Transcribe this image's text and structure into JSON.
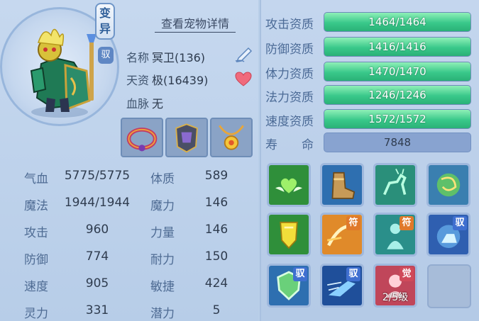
{
  "pet": {
    "mutant_label_1": "变",
    "mutant_label_2": "异",
    "skill_badge": "驭",
    "detail_link": "查看宠物详情",
    "name_label": "名称",
    "name_value": "冥卫(136)",
    "talent_label": "天资",
    "talent_value": "极(16439)",
    "blood_label": "血脉",
    "blood_value": "无"
  },
  "attributes": [
    {
      "label1": "气血",
      "value1": "5775/5775",
      "label2": "体质",
      "value2": "589"
    },
    {
      "label1": "魔法",
      "value1": "1944/1944",
      "label2": "魔力",
      "value2": "146"
    },
    {
      "label1": "攻击",
      "value1": "960",
      "label2": "力量",
      "value2": "146"
    },
    {
      "label1": "防御",
      "value1": "774",
      "label2": "耐力",
      "value2": "150"
    },
    {
      "label1": "速度",
      "value1": "905",
      "label2": "敏捷",
      "value2": "424"
    },
    {
      "label1": "灵力",
      "value1": "331",
      "label2": "潜力",
      "value2": "5"
    }
  ],
  "aptitudes": [
    {
      "label": "攻击资质",
      "text": "1464/1464",
      "current": 1464,
      "max": 1464
    },
    {
      "label": "防御资质",
      "text": "1416/1416",
      "current": 1416,
      "max": 1416
    },
    {
      "label": "体力资质",
      "text": "1470/1470",
      "current": 1470,
      "max": 1470
    },
    {
      "label": "法力资质",
      "text": "1246/1246",
      "current": 1246,
      "max": 1246
    },
    {
      "label": "速度资质",
      "text": "1572/1572",
      "current": 1572,
      "max": 1572
    }
  ],
  "lifespan": {
    "label": "寿　　命",
    "value": "7848"
  },
  "skills": {
    "badge_fu": "符",
    "badge_yu": "驭",
    "badge_jue": "觉",
    "level_text": "2/5级"
  },
  "colors": {
    "accent_green": "#39c88a",
    "badge_yu": "#3f6fd0",
    "badge_fu": "#e0792a",
    "badge_jue": "#d04a5a"
  }
}
